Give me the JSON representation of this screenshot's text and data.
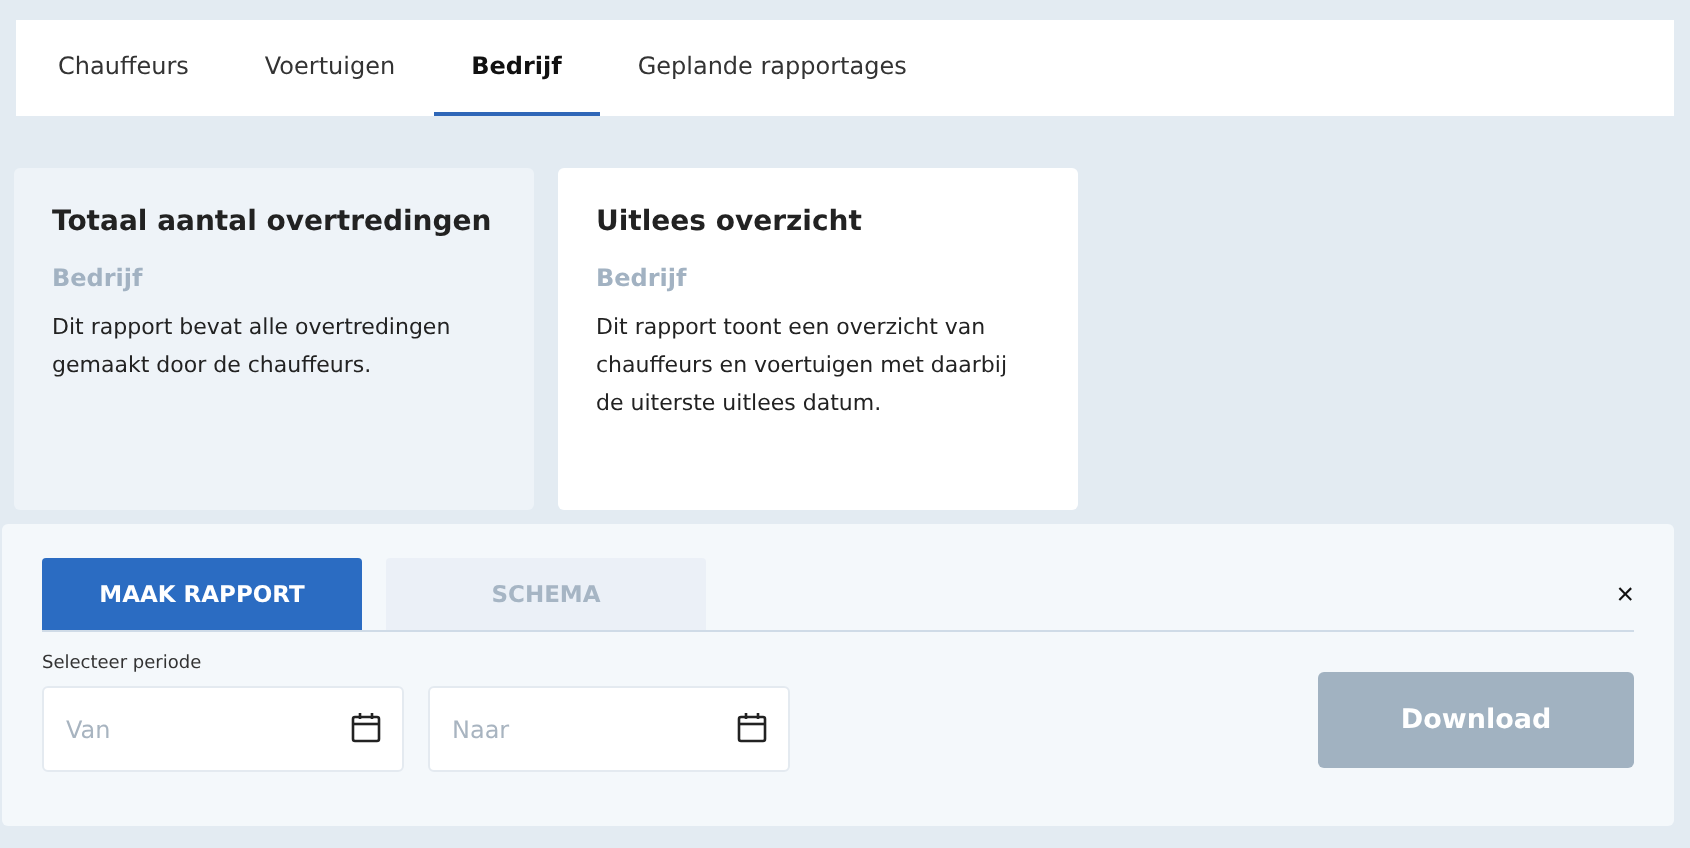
{
  "tabs": [
    {
      "label": "Chauffeurs",
      "selected": false
    },
    {
      "label": "Voertuigen",
      "selected": false
    },
    {
      "label": "Bedrijf",
      "selected": true
    },
    {
      "label": "Geplande rapportages",
      "selected": false
    }
  ],
  "reports": [
    {
      "title": "Totaal aantal overtredingen",
      "category": "Bedrijf",
      "description": "Dit rapport bevat alle overtredingen gemaakt door de chauffeurs.",
      "selected": true
    },
    {
      "title": "Uitlees overzicht",
      "category": "Bedrijf",
      "description": "Dit rapport toont een overzicht van chauffeurs en voertuigen met daarbij de uiterste uitlees datum.",
      "selected": false
    }
  ],
  "panel": {
    "tabs": [
      {
        "label": "MAAK RAPPORT",
        "selected": true
      },
      {
        "label": "SCHEMA",
        "selected": false
      }
    ],
    "close": "×",
    "period_label": "Selecteer periode",
    "fields": [
      {
        "placeholder": "Van"
      },
      {
        "placeholder": "Naar"
      }
    ],
    "download": {
      "label": "Download",
      "disabled": true
    }
  }
}
